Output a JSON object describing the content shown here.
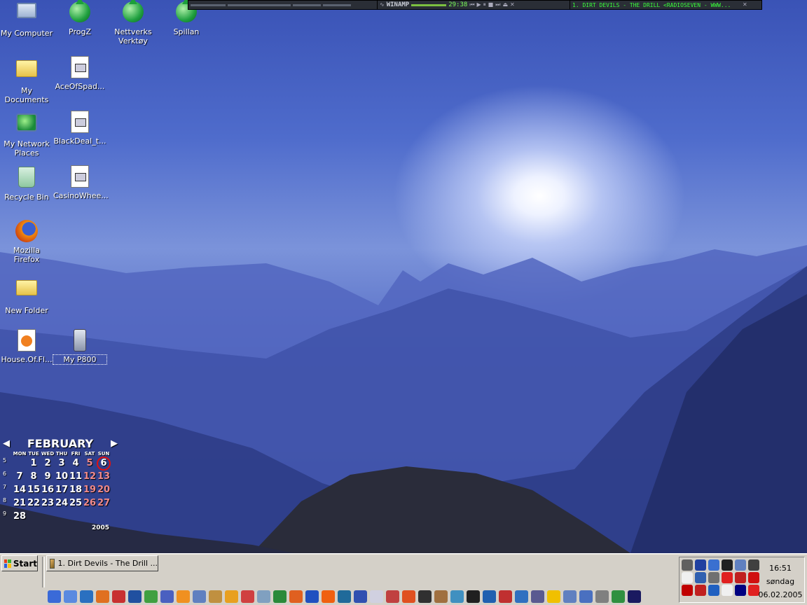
{
  "desktop": {
    "icons": [
      {
        "label": "My Computer",
        "icon": "computer-icon"
      },
      {
        "label": "ProgZ",
        "icon": "globe-shortcut-icon"
      },
      {
        "label": "Nettverks Verktøy",
        "icon": "globe-shortcut-icon"
      },
      {
        "label": "Spillan",
        "icon": "globe-shortcut-icon"
      },
      {
        "label": "My Documents",
        "icon": "documents-folder-icon"
      },
      {
        "label": "AceOfSpad...",
        "icon": "executable-file-icon"
      },
      {
        "label": "My Network Places",
        "icon": "network-icon"
      },
      {
        "label": "BlackDeal_t...",
        "icon": "executable-file-icon"
      },
      {
        "label": "Recycle Bin",
        "icon": "recycle-bin-icon"
      },
      {
        "label": "CasinoWhee...",
        "icon": "executable-file-icon"
      },
      {
        "label": "Mozilla Firefox",
        "icon": "firefox-icon"
      },
      {
        "label": "New Folder",
        "icon": "folder-icon"
      },
      {
        "label": "House.Of.Fl...",
        "icon": "media-file-icon"
      },
      {
        "label": "My P800",
        "icon": "phone-icon"
      }
    ]
  },
  "winamp": {
    "title": "WINAMP",
    "time": "29:38",
    "song": "1. DIRT DEVILS - THE DRILL <RADIOSEVEN - WWW..."
  },
  "calendar": {
    "month": "FEBRUARY",
    "year": "2005",
    "weekdays": [
      "MON",
      "TUE",
      "WED",
      "THU",
      "FRI",
      "SAT",
      "SUN"
    ],
    "weeks": [
      {
        "num": "5",
        "days": [
          "",
          "1",
          "2",
          "3",
          "4",
          "5",
          "6"
        ]
      },
      {
        "num": "6",
        "days": [
          "7",
          "8",
          "9",
          "10",
          "11",
          "12",
          "13"
        ]
      },
      {
        "num": "7",
        "days": [
          "14",
          "15",
          "16",
          "17",
          "18",
          "19",
          "20"
        ]
      },
      {
        "num": "8",
        "days": [
          "21",
          "22",
          "23",
          "24",
          "25",
          "26",
          "27"
        ]
      },
      {
        "num": "9",
        "days": [
          "28",
          "",
          "",
          "",
          "",
          "",
          ""
        ]
      }
    ],
    "today": "6"
  },
  "taskbar": {
    "start_label": "Start",
    "task_label": "1. Dirt Devils - The Drill ...",
    "quick_launch_count": 37,
    "tray_icon_count": 18,
    "clock": {
      "time": "16:51",
      "day": "søndag",
      "date": "06.02.2005"
    }
  },
  "colors": {
    "weekend": "#f08a8a",
    "today_ring": "#e01010",
    "taskbar": "#d4d0c8"
  }
}
